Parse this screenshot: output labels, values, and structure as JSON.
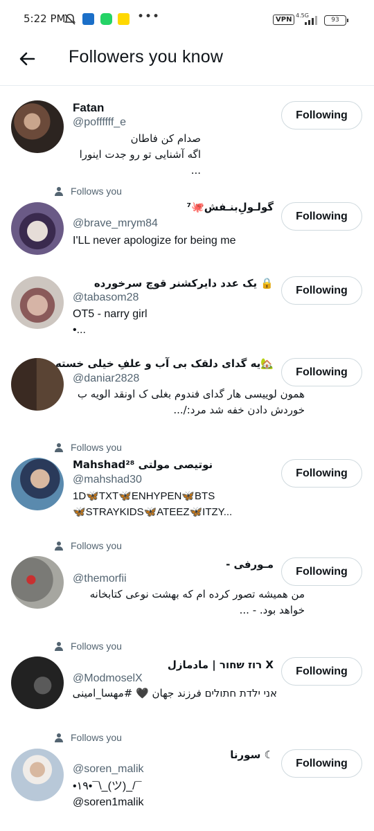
{
  "status_bar": {
    "time": "5:22 PM",
    "dots": "•••",
    "vpn": "VPN",
    "network": "4.5G",
    "battery": "93"
  },
  "header": {
    "title": "Followers you know",
    "back_icon": "arrow-left-icon"
  },
  "follow_button_label": "Following",
  "follows_you_label": "Follows you",
  "users": [
    {
      "name": "Fatan",
      "handle": "@poffffff_e",
      "bio": "صدام کن فاطان\nاگه آشنایی تو رو جدت اینورا ...",
      "follows_you": false,
      "avatar_color": "#6b4a3a"
    },
    {
      "name": "گولـولِ‌بنـفش🐙⁷",
      "handle": "@brave_mrym84",
      "bio": "I'LL never apologize for being me",
      "follows_you": true,
      "avatar_color": "#5a4a6e"
    },
    {
      "name": "یک عدد دایرکشنر قوچ سرخورده 🔒",
      "handle": "@tabasom28",
      "bio": "OT5 - narry girl\n•...",
      "follows_you": false,
      "avatar_color": "#a88a86"
    },
    {
      "name": "یه گدای دلقک بی آب و علفِ خیلی خسته🏡",
      "handle": "@daniar2828",
      "bio": "همون لوییسی هار گدای فندوم بغلی ک اونقد الویه ب خوردش دادن خفه شد مرد:/...",
      "follows_you": false,
      "avatar_color": "#4a3a30"
    },
    {
      "name": "Mahshad²⁸ نوتیصی مولتی",
      "handle": "@mahshad30",
      "bio": "1D🦋TXT🦋ENHYPEN🦋BTS\n🦋STRAYKIDS🦋ATEEZ🦋ITZY...",
      "follows_you": true,
      "avatar_color": "#3a6e8e"
    },
    {
      "name": "- مـورفی",
      "handle": "@themorfii",
      "bio": "من همیشه تصور کرده ام که بهشت نوعی کتابخانه خواهد بود.                -  ...",
      "follows_you": true,
      "avatar_color": "#8a8a86"
    },
    {
      "name": "רוז שחור | مادمازل X",
      "handle": "@ModmoselX",
      "bio": "אני ילדת חתולים فرزند جهان 🖤 #مهسا_امینی",
      "follows_you": true,
      "avatar_color": "#2a2a2a"
    },
    {
      "name": "سورنا ☾",
      "handle": "@soren_malik",
      "bio": "•۱۹•¯\\_(ツ)_/¯\n@soren1malik",
      "follows_you": true,
      "avatar_color": "#c8c0b8"
    }
  ]
}
